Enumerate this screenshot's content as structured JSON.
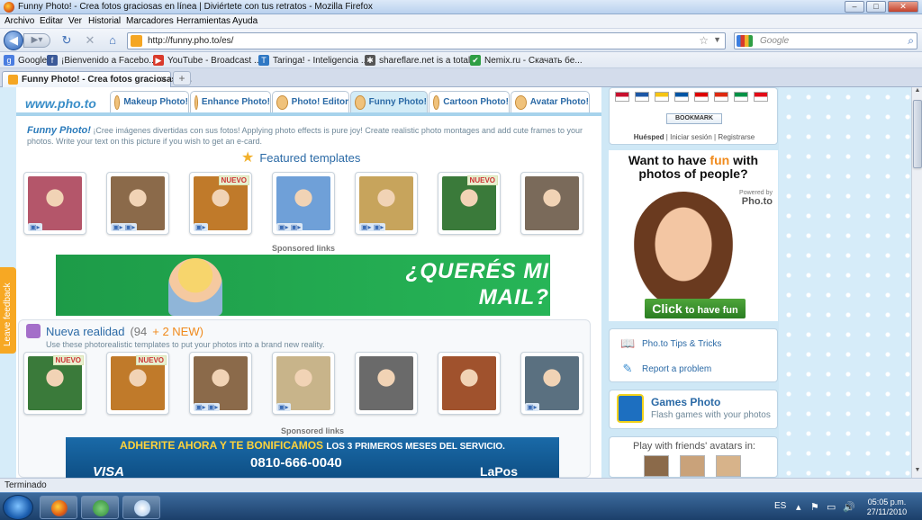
{
  "window": {
    "title": "Funny Photo! - Crea fotos graciosas en línea | Diviértete con tus retratos - Mozilla Firefox",
    "buttons": {
      "minimize": "–",
      "maximize": "□",
      "close": "✕"
    }
  },
  "menu": [
    "Archivo",
    "Editar",
    "Ver",
    "Historial",
    "Marcadores",
    "Herramientas",
    "Ayuda"
  ],
  "nav": {
    "back_icon": "back-arrow-icon",
    "url": "http://funny.pho.to/es/",
    "search_placeholder": "Google"
  },
  "bookmarks": [
    {
      "label": "Google",
      "icon": "google-icon",
      "color": "#4a7de0",
      "glyph": "g"
    },
    {
      "label": "¡Bienvenido a Facebo...",
      "icon": "facebook-icon",
      "color": "#3b5998",
      "glyph": "f"
    },
    {
      "label": "YouTube - Broadcast ...",
      "icon": "youtube-icon",
      "color": "#d93a2b",
      "glyph": "▶"
    },
    {
      "label": "Taringa! - Inteligencia ...",
      "icon": "taringa-icon",
      "color": "#2f78c4",
      "glyph": "T"
    },
    {
      "label": "shareflare.net is a total...",
      "icon": "shareflare-icon",
      "color": "#555555",
      "glyph": "✱"
    },
    {
      "label": "Nemix.ru - Скачать бе...",
      "icon": "check-icon",
      "color": "#2f9e44",
      "glyph": "✔"
    }
  ],
  "tabs": {
    "active": "Funny Photo! - Crea fotos graciosas e...",
    "close": "×",
    "new": "+"
  },
  "site": {
    "logo": "www.pho.to",
    "tabs": [
      "Makeup Photo!",
      "Enhance Photo!",
      "Photo! Editor",
      "Funny Photo!",
      "Cartoon Photo!",
      "Avatar Photo!"
    ],
    "tab_colors": [
      "#e6e0f3",
      "#d7ecc9",
      "#d7e3f3",
      "#d3ecf7",
      "#fbe6b8",
      "#d5eec8"
    ],
    "intro_title": "Funny Photo!",
    "intro_text": "¡Cree imágenes divertidas con sus fotos! Applying photo effects is pure joy! Create realistic photo montages and add cute frames to your photos. Write your text on this picture if you wish to get an e-card.",
    "featured_title": "Featured templates",
    "nuevo": "NUEVO",
    "sponsored": "Sponsored links",
    "featured": [
      {
        "color": "#b4566a",
        "nuevo": false,
        "badge": "▣▸"
      },
      {
        "color": "#8b6a4a",
        "nuevo": false,
        "badge": "▣▸ ▣▸"
      },
      {
        "color": "#c07a2a",
        "nuevo": true,
        "badge": "▣▸"
      },
      {
        "color": "#6fa0d8",
        "nuevo": false,
        "badge": "▣▸ ▣▸"
      },
      {
        "color": "#c7a45c",
        "nuevo": false,
        "badge": "▣▸ ▣▸"
      },
      {
        "color": "#3a7a3a",
        "nuevo": true,
        "badge": ""
      },
      {
        "color": "#7a6a5a",
        "nuevo": false,
        "badge": ""
      }
    ],
    "ad1_text": "¿QUERÉS MI MAIL?",
    "section2": {
      "title": "Nueva realidad",
      "count": "(94",
      "new": "+ 2 NEW)",
      "subtitle": "Use these photorealistic templates to put your photos into a brand new reality.",
      "items": [
        {
          "color": "#3a7a3a",
          "nuevo": true,
          "badge": ""
        },
        {
          "color": "#c07a2a",
          "nuevo": true,
          "badge": ""
        },
        {
          "color": "#8b6a4a",
          "nuevo": false,
          "badge": "▣▸ ▣▸"
        },
        {
          "color": "#c8b48a",
          "nuevo": false,
          "badge": "▣▸"
        },
        {
          "color": "#6a6a6a",
          "nuevo": false,
          "badge": ""
        },
        {
          "color": "#a0522d",
          "nuevo": false,
          "badge": ""
        },
        {
          "color": "#5a7080",
          "nuevo": false,
          "badge": "▣▸"
        }
      ]
    },
    "ad2": {
      "line1": "ADHERITE AHORA Y TE BONIFICAMOS",
      "line1b": "LOS 3 PRIMEROS MESES DEL SERVICIO.",
      "phone": "0810-666-0040",
      "visa": "VISA",
      "brand": "LaPos"
    },
    "feedback": "Leave feedback"
  },
  "sidebar": {
    "flags": [
      "#c8102e",
      "#1c57a5",
      "#f6c413",
      "#0055a4",
      "#dd0000",
      "#de2910",
      "#009246",
      "#e30a17"
    ],
    "bookmark": "BOOKMARK",
    "guest": "Huésped",
    "login": "Iniciar sesión",
    "register": "Registrarse",
    "ad_head1": "Want to have",
    "ad_fun": "fun",
    "ad_head1b": "with",
    "ad_head2": "photos of people?",
    "powered": "Powered by",
    "powered_brand": "Pho.to",
    "click": "Click",
    "click_rest": "to have fun",
    "tips": "Pho.to Tips & Tricks",
    "report": "Report a problem",
    "games_title": "Games Photo",
    "games_sub": "Flash games with your photos",
    "friends": "Play with friends' avatars in:"
  },
  "status": "Terminado",
  "taskbar": {
    "lang": "ES",
    "time": "05:05 p.m.",
    "date": "27/11/2010"
  }
}
